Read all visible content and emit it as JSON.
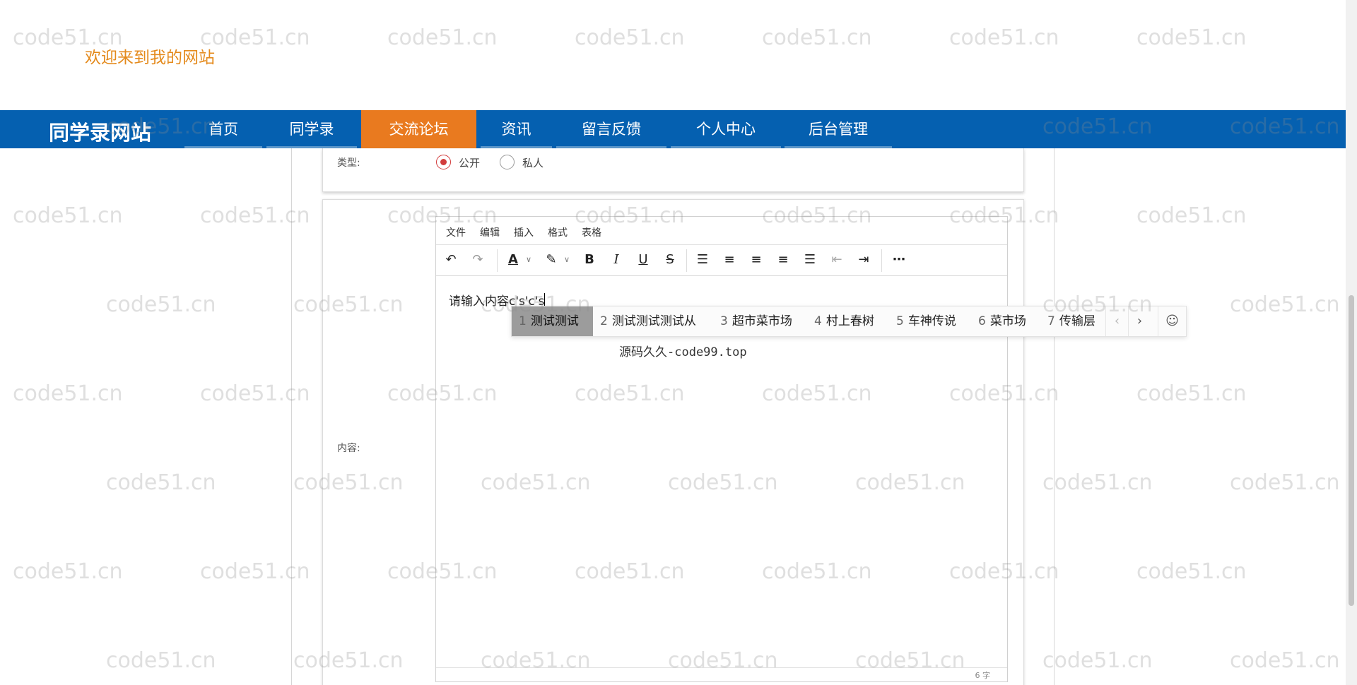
{
  "header": {
    "welcome_text": "欢迎来到我的网站"
  },
  "navbar": {
    "site_title": "同学录网站",
    "items": [
      {
        "label": "首页",
        "active": false
      },
      {
        "label": "同学录",
        "active": false
      },
      {
        "label": "交流论坛",
        "active": true
      },
      {
        "label": "资讯",
        "active": false
      },
      {
        "label": "留言反馈",
        "active": false
      },
      {
        "label": "个人中心",
        "active": false
      },
      {
        "label": "后台管理",
        "active": false
      }
    ]
  },
  "form": {
    "type_label": "类型:",
    "type_options": [
      {
        "label": "公开",
        "checked": true
      },
      {
        "label": "私人",
        "checked": false
      }
    ],
    "content_label": "内容:"
  },
  "editor": {
    "menu": [
      "文件",
      "编辑",
      "插入",
      "格式",
      "表格"
    ],
    "content_text": "请输入内容c's'c's",
    "word_count": "6 字",
    "toolbar_icons": [
      "undo-icon",
      "redo-icon",
      "font-color-icon",
      "highlight-icon",
      "bold-icon",
      "italic-icon",
      "underline-icon",
      "strikethrough-icon",
      "line-height-icon",
      "align-left-icon",
      "align-center-icon",
      "align-right-icon",
      "align-justify-icon",
      "outdent-icon",
      "indent-icon",
      "more-icon"
    ]
  },
  "ime": {
    "candidates": [
      {
        "num": "1",
        "text": "测试测试"
      },
      {
        "num": "2",
        "text": "测试测试测试从"
      },
      {
        "num": "3",
        "text": "超市菜市场"
      },
      {
        "num": "4",
        "text": "村上春树"
      },
      {
        "num": "5",
        "text": "车神传说"
      },
      {
        "num": "6",
        "text": "菜市场"
      },
      {
        "num": "7",
        "text": "传输层"
      }
    ],
    "sub_text": "源码久久-code99.top"
  },
  "watermark_text": "code51.cn",
  "colors": {
    "nav_bg": "#0560b0",
    "nav_active": "#e97a1f",
    "welcome": "#e48a1c",
    "radio_checked": "#d23c3c"
  }
}
